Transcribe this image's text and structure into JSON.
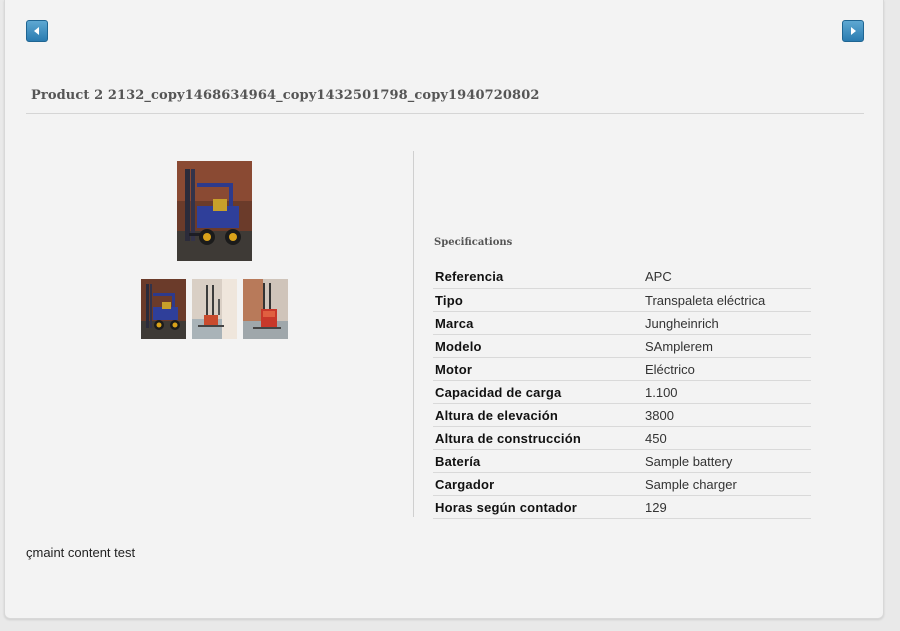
{
  "navigation": {
    "prev_icon": "arrow-left-icon",
    "next_icon": "arrow-right-icon",
    "button_color": "#3a8bbf"
  },
  "product": {
    "title": "Product 2 2132_copy1468634964_copy1432501798_copy1940720802"
  },
  "gallery": {
    "main_image": "forklift-photo",
    "thumbnails": [
      "forklift-photo",
      "stacker-photo",
      "pallet-truck-photo"
    ]
  },
  "specifications": {
    "heading": "Specifications",
    "rows": [
      {
        "key": "Referencia",
        "value": "APC"
      },
      {
        "key": "Tipo",
        "value": "Transpaleta eléctrica"
      },
      {
        "key": "Marca",
        "value": "Jungheinrich"
      },
      {
        "key": "Modelo",
        "value": "SAmplerem"
      },
      {
        "key": "Motor",
        "value": "Eléctrico"
      },
      {
        "key": "Capacidad de carga",
        "value": "1.100"
      },
      {
        "key": "Altura de elevación",
        "value": "3800"
      },
      {
        "key": "Altura de construcción",
        "value": "450"
      },
      {
        "key": "Batería",
        "value": "Sample battery"
      },
      {
        "key": "Cargador",
        "value": "Sample charger"
      },
      {
        "key": "Horas según contador",
        "value": "129"
      }
    ]
  },
  "content": {
    "text": "çmaint content test"
  }
}
